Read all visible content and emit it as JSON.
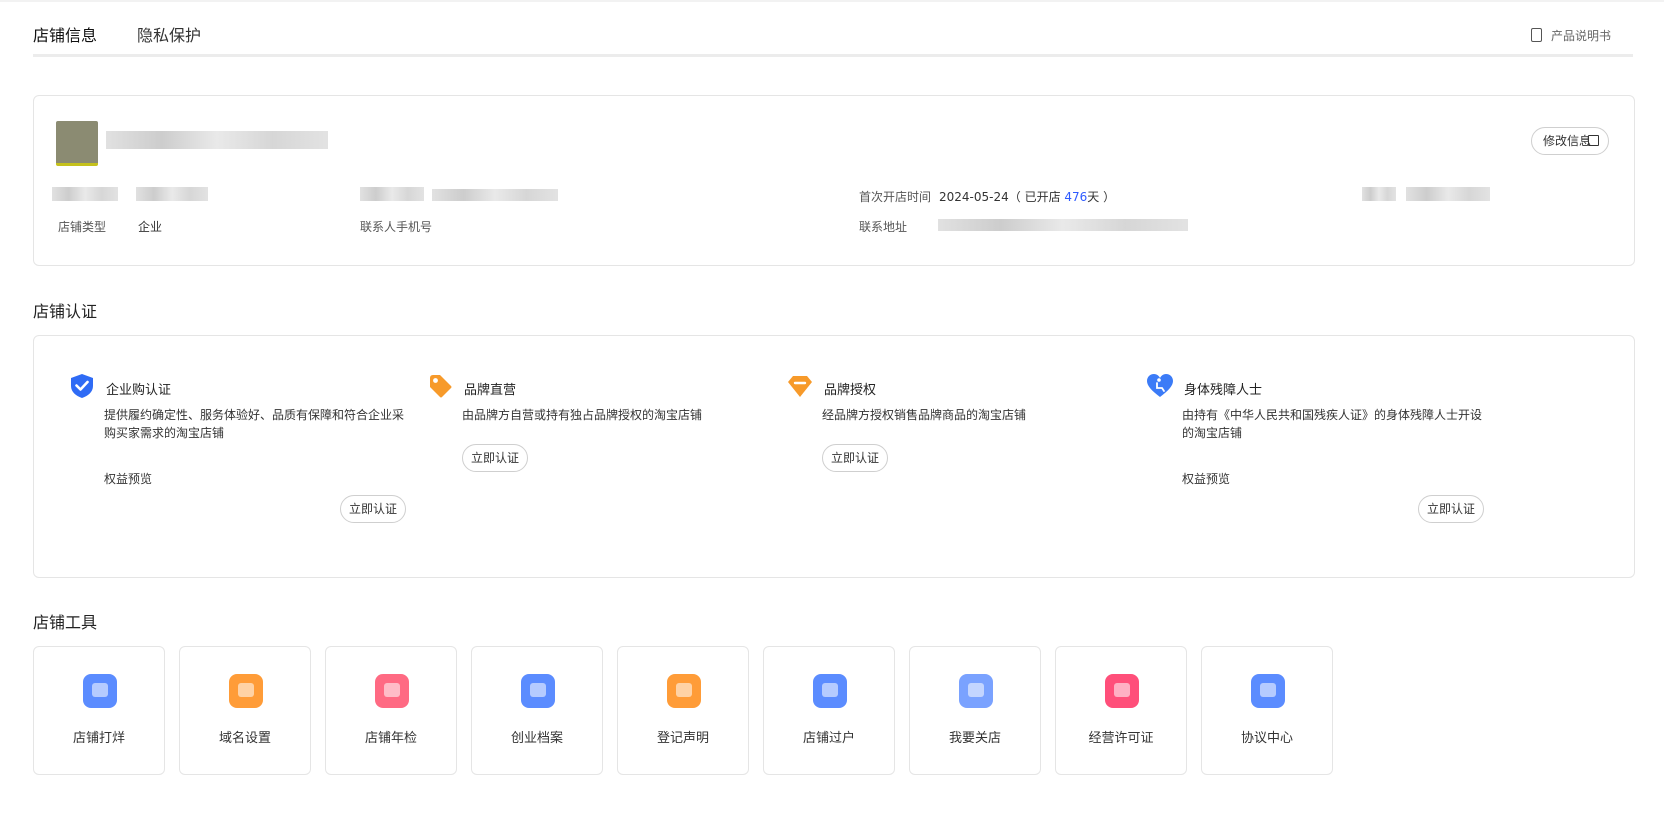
{
  "tabs": [
    {
      "label": "店铺信息",
      "active": true
    },
    {
      "label": "隐私保护",
      "active": false
    }
  ],
  "manual_label": "产品说明书",
  "shop": {
    "edit_label": "修改信息",
    "open_time_label": "首次开店时间",
    "open_date": "2024-05-24",
    "open_days_prefix": "（ 已开店 ",
    "open_days": "476",
    "open_days_suffix": "天 ）",
    "type_label": "店铺类型",
    "type_value": "企业",
    "phone_label": "联系人手机号",
    "address_label": "联系地址"
  },
  "certification": {
    "section_title": "店铺认证",
    "items": [
      {
        "title": "企业购认证",
        "desc": "提供履约确定性、服务体验好、品质有保障和符合企业采购买家需求的淘宝店铺",
        "benefit": "权益预览",
        "button": "立即认证",
        "icon": "shield-check-icon",
        "color": "#2f6bf5"
      },
      {
        "title": "品牌直营",
        "desc": "由品牌方自营或持有独占品牌授权的淘宝店铺",
        "benefit": "",
        "button": "立即认证",
        "icon": "tag-icon",
        "color": "#f79a2a"
      },
      {
        "title": "品牌授权",
        "desc": "经品牌方授权销售品牌商品的淘宝店铺",
        "benefit": "",
        "button": "立即认证",
        "icon": "diamond-icon",
        "color": "#f79a2a"
      },
      {
        "title": "身体残障人士",
        "desc": "由持有《中华人民共和国残疾人证》的身体残障人士开设的淘宝店铺",
        "benefit": "权益预览",
        "button": "立即认证",
        "icon": "heart-accessibility-icon",
        "color": "#3b7bf7"
      }
    ]
  },
  "tools": {
    "section_title": "店铺工具",
    "items": [
      {
        "label": "店铺打烊",
        "icon": "shop-close-icon",
        "color": "#5b8cff"
      },
      {
        "label": "域名设置",
        "icon": "domain-icon",
        "color": "#ff9c38"
      },
      {
        "label": "店铺年检",
        "icon": "shield-search-icon",
        "color": "#ff6a83"
      },
      {
        "label": "创业档案",
        "icon": "archive-icon",
        "color": "#5b8cff"
      },
      {
        "label": "登记声明",
        "icon": "declaration-icon",
        "color": "#ff9c38"
      },
      {
        "label": "店铺过户",
        "icon": "transfer-icon",
        "color": "#5b8cff"
      },
      {
        "label": "我要关店",
        "icon": "close-shop-icon",
        "color": "#7aa2ff"
      },
      {
        "label": "经营许可证",
        "icon": "license-folder-icon",
        "color": "#ff4f7a"
      },
      {
        "label": "协议中心",
        "icon": "agreement-icon",
        "color": "#5b8cff"
      }
    ]
  }
}
